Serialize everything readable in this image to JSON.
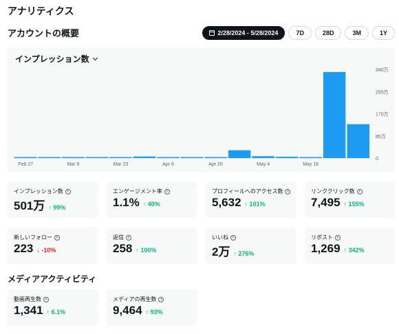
{
  "page_title": "アナリティクス",
  "overview_title": "アカウントの概要",
  "ranges": [
    {
      "label": "2/28/2024 - 5/28/2024",
      "active": true,
      "icon": "calendar-icon"
    },
    {
      "label": "7D",
      "active": false
    },
    {
      "label": "28D",
      "active": false
    },
    {
      "label": "3M",
      "active": false
    },
    {
      "label": "1Y",
      "active": false
    }
  ],
  "chart_title": "インプレッション数",
  "chart_data": {
    "type": "bar",
    "title": "インプレッション数",
    "x_tick_labels": [
      "Feb 27",
      "Mar 9",
      "Mar 23",
      "Apr 6",
      "Apr 20",
      "May 4",
      "May 18"
    ],
    "y_tick_labels": [
      "340万",
      "255万",
      "170万",
      "85万",
      "0"
    ],
    "ylim": [
      0,
      3400000
    ],
    "values": [
      40000,
      30000,
      20000,
      25000,
      15000,
      60000,
      20000,
      15000,
      10000,
      300000,
      70000,
      50000,
      10000,
      3300000,
      1300000
    ],
    "grid": false,
    "bar_color": "#1d9bf0"
  },
  "stats": [
    {
      "label": "インプレッション数",
      "value": "501万",
      "change": "99%",
      "direction": "up"
    },
    {
      "label": "エンゲージメント率",
      "value": "1.1%",
      "change": "40%",
      "direction": "up"
    },
    {
      "label": "プロフィールへのアクセス数",
      "value": "5,632",
      "change": "101%",
      "direction": "up"
    },
    {
      "label": "リンククリック数",
      "value": "7,495",
      "change": "155%",
      "direction": "up"
    },
    {
      "label": "新しいフォロー",
      "value": "223",
      "change": "-10%",
      "direction": "down"
    },
    {
      "label": "返信",
      "value": "258",
      "change": "100%",
      "direction": "up"
    },
    {
      "label": "いいね",
      "value": "2万",
      "change": "276%",
      "direction": "up"
    },
    {
      "label": "リポスト",
      "value": "1,269",
      "change": "342%",
      "direction": "up"
    }
  ],
  "media_title": "メディアアクティビティ",
  "media_stats": [
    {
      "label": "動画再生数",
      "value": "1,341",
      "change": "6.1%",
      "direction": "up"
    },
    {
      "label": "メディアの再生数",
      "value": "9,464",
      "change": "93%",
      "direction": "up"
    }
  ],
  "arrow_up": "↑",
  "arrow_down": "↓",
  "info_glyph": "i"
}
